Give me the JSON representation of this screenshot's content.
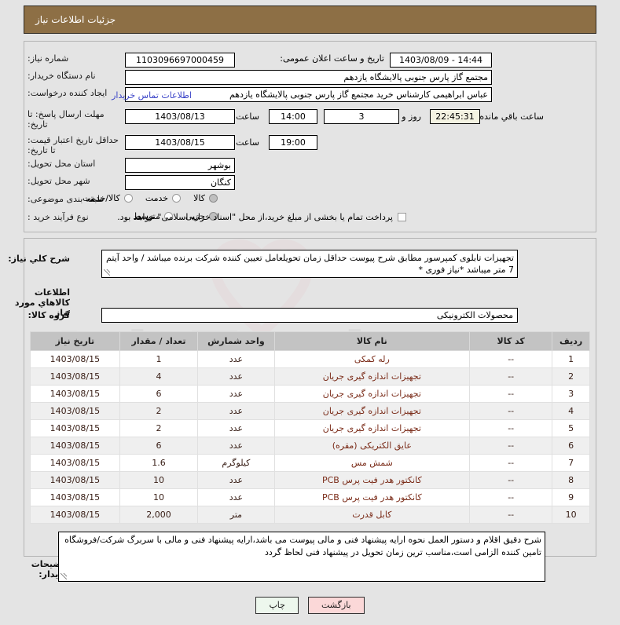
{
  "header": {
    "title": "جزئیات اطلاعات نیاز"
  },
  "form": {
    "need_number": {
      "label": "شماره نیاز:",
      "value": "1103096697000459"
    },
    "public_announce": {
      "label": "تاریخ و ساعت اعلان عمومی:",
      "value": "1403/08/09 - 14:44"
    },
    "buyer_org": {
      "label": "نام دستگاه خریدار:",
      "value": "مجتمع گاز پارس جنوبی  پالایشگاه یازدهم"
    },
    "requester": {
      "label": "ایجاد کننده درخواست:",
      "value": "عباس ابراهیمی کارشناس خرید مجتمع گاز پارس جنوبی  پالایشگاه یازدهم"
    },
    "buyer_contact_link": "اطلاعات تماس خریدار",
    "response_deadline": {
      "label": "مهلت ارسال پاسخ: تا تاریخ:",
      "date": "1403/08/13",
      "time_label": "ساعت",
      "time": "14:00",
      "days": "3",
      "days_label": "روز و",
      "countdown": "22:45:31",
      "countdown_label": "ساعت باقي مانده"
    },
    "price_validity": {
      "label": "حداقل تاریخ اعتبار قیمت: تا تاریخ:",
      "date": "1403/08/15",
      "time_label": "ساعت",
      "time": "19:00"
    },
    "delivery_province": {
      "label": "استان محل تحویل:",
      "value": "بوشهر"
    },
    "delivery_city": {
      "label": "شهر محل تحویل:",
      "value": "کنگان"
    },
    "subject_category": {
      "label": "طبقه بندی موضوعی:",
      "options": [
        "کالا",
        "خدمت",
        "کالا/خدمت"
      ],
      "selected": "کالا"
    },
    "purchase_process": {
      "label": "نوع فرآیند خرید :",
      "options": [
        "جزیی",
        "متوسط"
      ],
      "selected": "جزیی"
    },
    "treasury_note": {
      "text": "پرداخت تمام یا بخشی از مبلغ خرید،از محل \"اسناد خزانه اسلامی\" خواهد بود.",
      "checked": false
    }
  },
  "general_desc": {
    "label": "شرح کلي نیاز:",
    "value": "تجهیزات تابلوی کمپرسور مطابق شرح پیوست حداقل زمان تحویلعامل تعیین کننده شرکت برنده میباشد / واحد آیتم 7 متر میباشد *نیاز فوری *"
  },
  "goods_section": {
    "heading": "اطلاعات کالاهاي مورد نیاز",
    "group_label": "گروه کالا:",
    "group_value": "محصولات الکترونیکی"
  },
  "items_table": {
    "columns": [
      "ردیف",
      "کد کالا",
      "نام کالا",
      "واحد شمارش",
      "تعداد / مقدار",
      "تاریخ نیاز"
    ],
    "rows": [
      [
        "1",
        "--",
        "رله کمکی",
        "عدد",
        "1",
        "1403/08/15"
      ],
      [
        "2",
        "--",
        "تجهیزات اندازه گیری جریان",
        "عدد",
        "4",
        "1403/08/15"
      ],
      [
        "3",
        "--",
        "تجهیزات اندازه گیری جریان",
        "عدد",
        "6",
        "1403/08/15"
      ],
      [
        "4",
        "--",
        "تجهیزات اندازه گیری جریان",
        "عدد",
        "2",
        "1403/08/15"
      ],
      [
        "5",
        "--",
        "تجهیزات اندازه گیری جریان",
        "عدد",
        "2",
        "1403/08/15"
      ],
      [
        "6",
        "--",
        "عایق الکتریکی (مقره)",
        "عدد",
        "6",
        "1403/08/15"
      ],
      [
        "7",
        "--",
        "شمش مس",
        "کیلوگرم",
        "1.6",
        "1403/08/15"
      ],
      [
        "8",
        "--",
        "کانکتور هدر فیت پرس PCB",
        "عدد",
        "10",
        "1403/08/15"
      ],
      [
        "9",
        "--",
        "کانکتور هدر فیت پرس PCB",
        "عدد",
        "10",
        "1403/08/15"
      ],
      [
        "10",
        "--",
        "کابل قدرت",
        "متر",
        "2,000",
        "1403/08/15"
      ]
    ]
  },
  "buyer_notes": {
    "label": "توضیحات خریدار:",
    "value": "شرح دقیق اقلام و دستور العمل نحوه ارایه پیشنهاد فنی و مالی پیوست می باشد،ارایه پیشنهاد فنی و مالی با سربرگ شرکت/فروشگاه تامین کننده الزامی است،مناسب ترین زمان تحویل در پیشنهاد فنی لحاظ گردد"
  },
  "buttons": {
    "print": "چاپ",
    "back": "بازگشت"
  },
  "watermark": {
    "text": "AriaTender.net"
  },
  "colors": {
    "titlebar": "#8d6f45",
    "link": "#3b44c8",
    "table_header": "#c3c3c3",
    "btn_print": "#edf7ed",
    "btn_back": "#fbd8d8",
    "countdown_bg": "#f4f3e2"
  }
}
